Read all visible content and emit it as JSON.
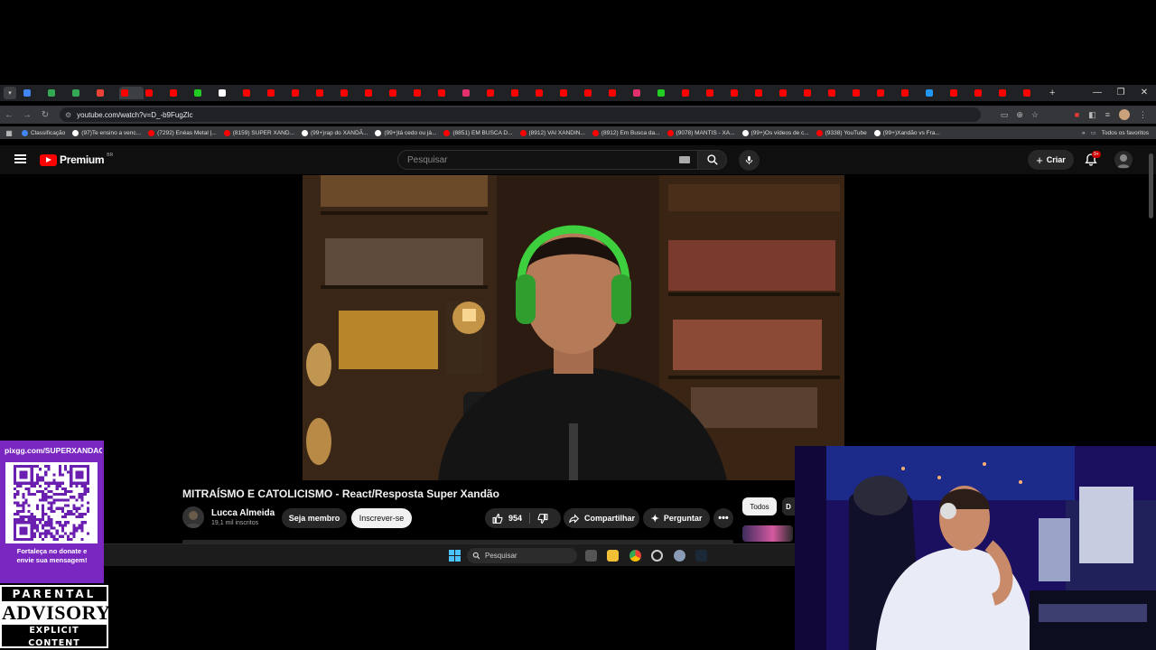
{
  "browser": {
    "tab_favicon_colors": [
      "#4285f4",
      "#34a853",
      "#34a853",
      "#ea4335",
      "#ff0000",
      "#ff0000",
      "#ff0000",
      "#22cc22",
      "#ffffff",
      "#ff0000",
      "#ff0000",
      "#ff0000",
      "#ff0000",
      "#ff0000",
      "#ff0000",
      "#ff0000",
      "#ff0000",
      "#ff0000",
      "#e1306c",
      "#ff0000",
      "#ff0000",
      "#ff0000",
      "#ff0000",
      "#ff0000",
      "#ff0000",
      "#e1306c",
      "#22cc22",
      "#ff0000",
      "#ff0000",
      "#ff0000",
      "#ff0000",
      "#ff0000",
      "#ff0000",
      "#ff0000",
      "#ff0000",
      "#ff0000",
      "#ff0000",
      "#2196f3",
      "#ff0000",
      "#ff0000",
      "#ff0000",
      "#ff0000"
    ],
    "url": "youtube.com/watch?v=D_-b9FugZlc",
    "bookmarks": [
      {
        "label": "Classificação",
        "color": "#4285f4"
      },
      {
        "label": "(97)Te ensino a venc...",
        "color": "#ffffff"
      },
      {
        "label": "(7292) Enéas Metal |...",
        "color": "#ff0000"
      },
      {
        "label": "(8159) SUPER XAND...",
        "color": "#ff0000"
      },
      {
        "label": "(99+)rap do XANDÃ...",
        "color": "#ffffff"
      },
      {
        "label": "(99+)tá cedo ou já...",
        "color": "#ffffff"
      },
      {
        "label": "(8851) EM BUSCA D...",
        "color": "#ff0000"
      },
      {
        "label": "(8912) VAI XANDIN...",
        "color": "#ff0000"
      },
      {
        "label": "(8912) Em Busca da...",
        "color": "#ff0000"
      },
      {
        "label": "(9078) MANTIS - XA...",
        "color": "#ff0000"
      },
      {
        "label": "(99+)Os vídeos de c...",
        "color": "#ffffff"
      },
      {
        "label": "(9338) YouTube",
        "color": "#ff0000"
      },
      {
        "label": "(99+)Xandão vs Fra...",
        "color": "#ffffff"
      }
    ],
    "all_bookmarks_label": "Todos os favoritos"
  },
  "youtube": {
    "logo_text": "Premium",
    "country": "BR",
    "search_placeholder": "Pesquisar",
    "create_label": "Criar",
    "notification_badge": "9+",
    "video": {
      "title": "MITRAÍSMO E CATOLICISMO - React/Resposta Super Xandão",
      "channel": "Lucca Almeida",
      "subscribers": "19,1 mil inscritos",
      "member_label": "Seja membro",
      "subscribe_label": "Inscrever-se",
      "likes": "954",
      "share_label": "Compartilhar",
      "ask_label": "Perguntar",
      "more_label": "•••"
    },
    "chips": {
      "active": "Todos",
      "next": "D"
    }
  },
  "taskbar": {
    "search_placeholder": "Pesquisar"
  },
  "overlay": {
    "donate_url": "pixgg.com/SUPERXANDAO",
    "donate_message_1": "Fortaleça no donate e",
    "donate_message_2": "envie sua mensagem!",
    "advisory_line1": "PARENTAL",
    "advisory_line2": "ADVISORY",
    "advisory_line3": "EXPLICIT CONTENT"
  },
  "colors": {
    "yt_red": "#ff0000",
    "yt_bg": "#0f0f0f",
    "overlay_purple": "#7a27c2"
  }
}
